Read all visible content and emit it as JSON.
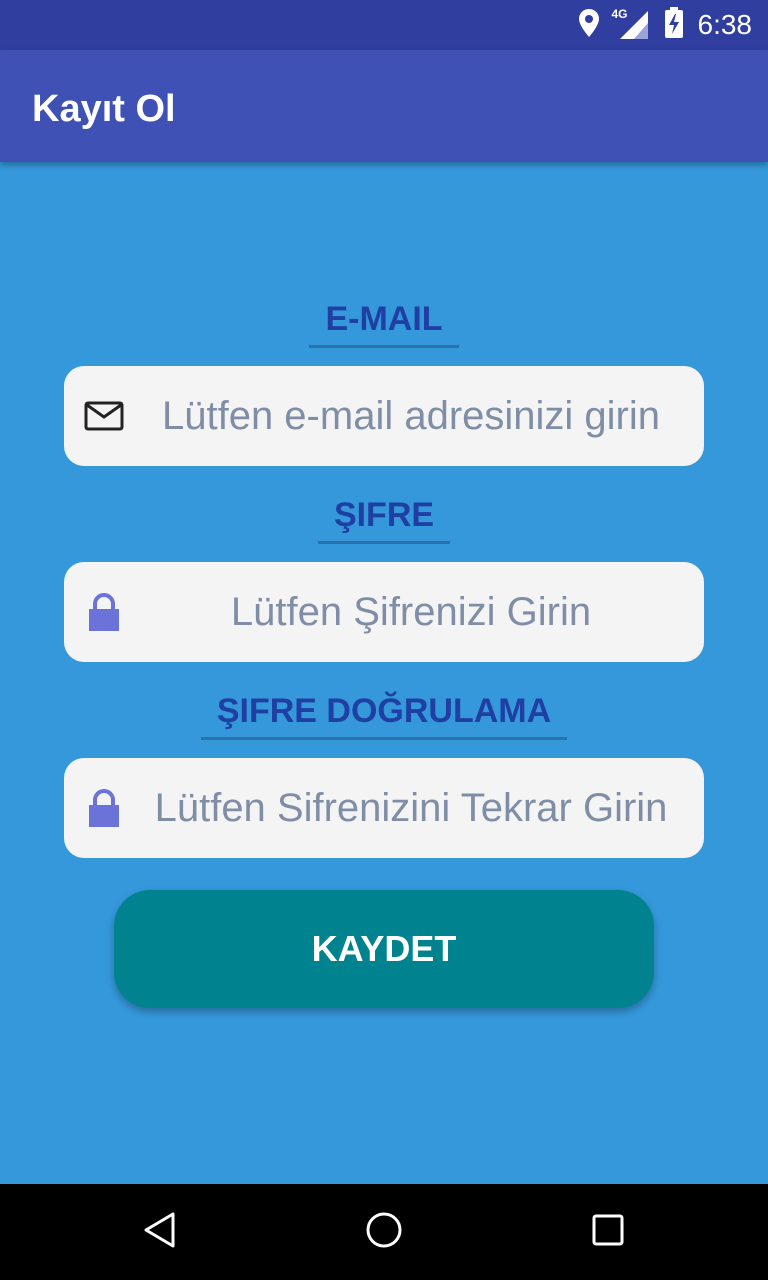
{
  "status_bar": {
    "time": "6:38",
    "network": "4G"
  },
  "app_bar": {
    "title": "Kayıt Ol"
  },
  "form": {
    "email": {
      "label": "E-MAIL",
      "placeholder": "Lütfen e-mail adresinizi girin",
      "icon": "mail-icon"
    },
    "password": {
      "label": "ŞIFRE",
      "placeholder": "Lütfen Şifrenizi Girin",
      "icon": "lock-icon"
    },
    "confirm": {
      "label": "ŞIFRE DOĞRULAMA",
      "placeholder": "Lütfen Sifrenizini Tekrar Girin",
      "icon": "lock-icon"
    },
    "submit_label": "KAYDET"
  },
  "colors": {
    "background": "#3598db",
    "app_bar": "#3f51b5",
    "status_bar": "#303f9f",
    "label": "#1f3fa3",
    "button": "#00838f",
    "lock_icon": "#6b72d8"
  }
}
